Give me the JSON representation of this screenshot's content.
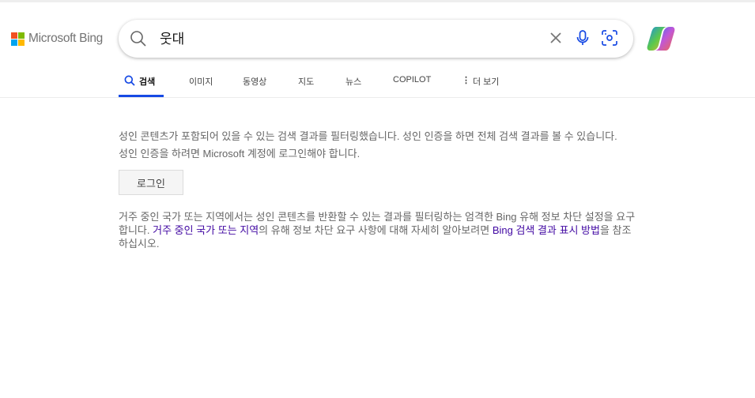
{
  "header": {
    "logo_text": "Microsoft Bing",
    "search_value": "웃대"
  },
  "colors": {
    "accent": "#174ae4",
    "link": "#4007a2"
  },
  "tabs": [
    {
      "label": "검색"
    },
    {
      "label": "이미지"
    },
    {
      "label": "동영상"
    },
    {
      "label": "지도"
    },
    {
      "label": "뉴스"
    },
    {
      "label": "COPILOT"
    },
    {
      "label": "더 보기"
    }
  ],
  "content": {
    "line1": "성인 콘텐츠가 포함되어 있을 수 있는 검색 결과를 필터링했습니다. 성인 인증을 하면 전체 검색 결과를 볼 수 있습니다.",
    "line2": "성인 인증을 하려면 Microsoft 계정에 로그인해야 합니다.",
    "login_label": "로그인",
    "p2_a": "거주 중인 국가 또는 지역에서는 성인 콘텐츠를 반환할 수 있는 결과를 필터링하는 엄격한 Bing 유해 정보 차단 설정을 요구합니다. ",
    "p2_link1": "거주 중인 국가 또는 지역",
    "p2_b": "의 유해 정보 차단 요구 사항에 대해 자세히 알아보려면 ",
    "p2_link2": "Bing 검색 결과 표시 방법",
    "p2_c": "을 참조하십시오."
  }
}
